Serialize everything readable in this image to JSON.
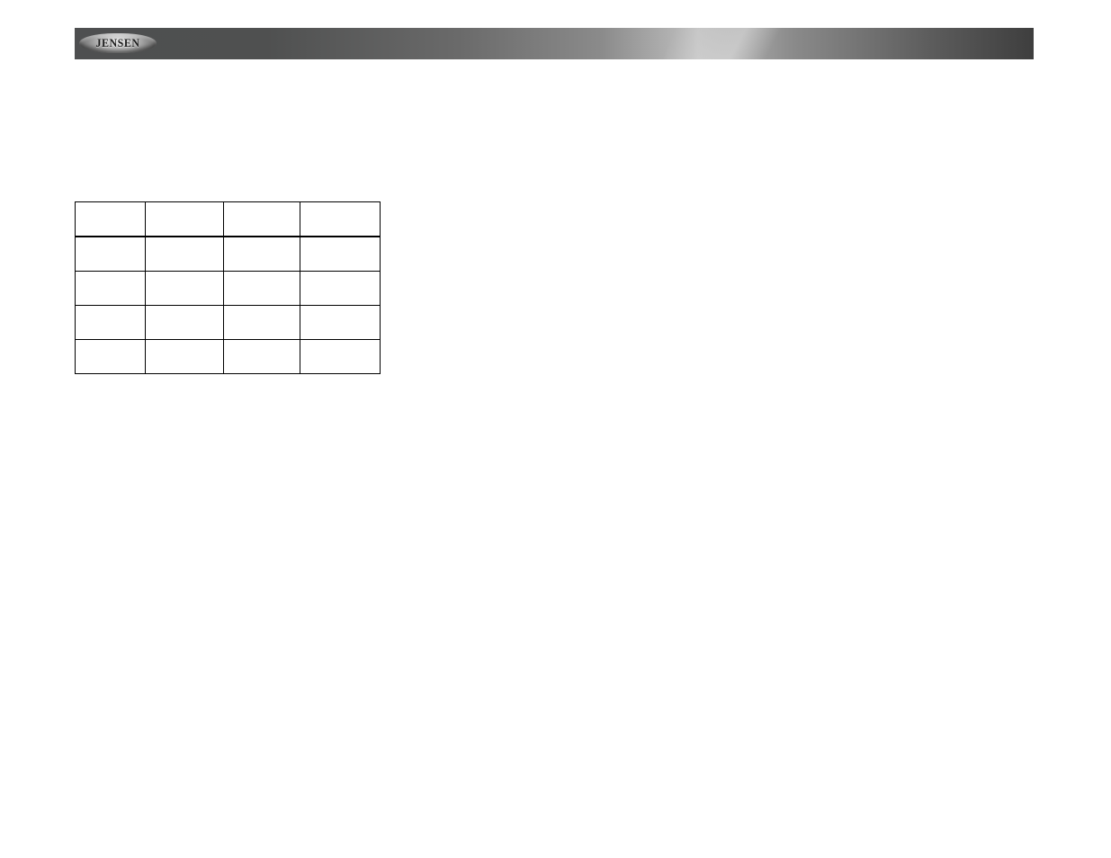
{
  "brand": {
    "logo_text": "JENSEN"
  },
  "table": {
    "columns": [
      "",
      "",
      "",
      ""
    ],
    "rows": [
      [
        "",
        "",
        "",
        ""
      ],
      [
        "",
        "",
        "",
        ""
      ],
      [
        "",
        "",
        "",
        ""
      ],
      [
        "",
        "",
        "",
        ""
      ]
    ]
  }
}
